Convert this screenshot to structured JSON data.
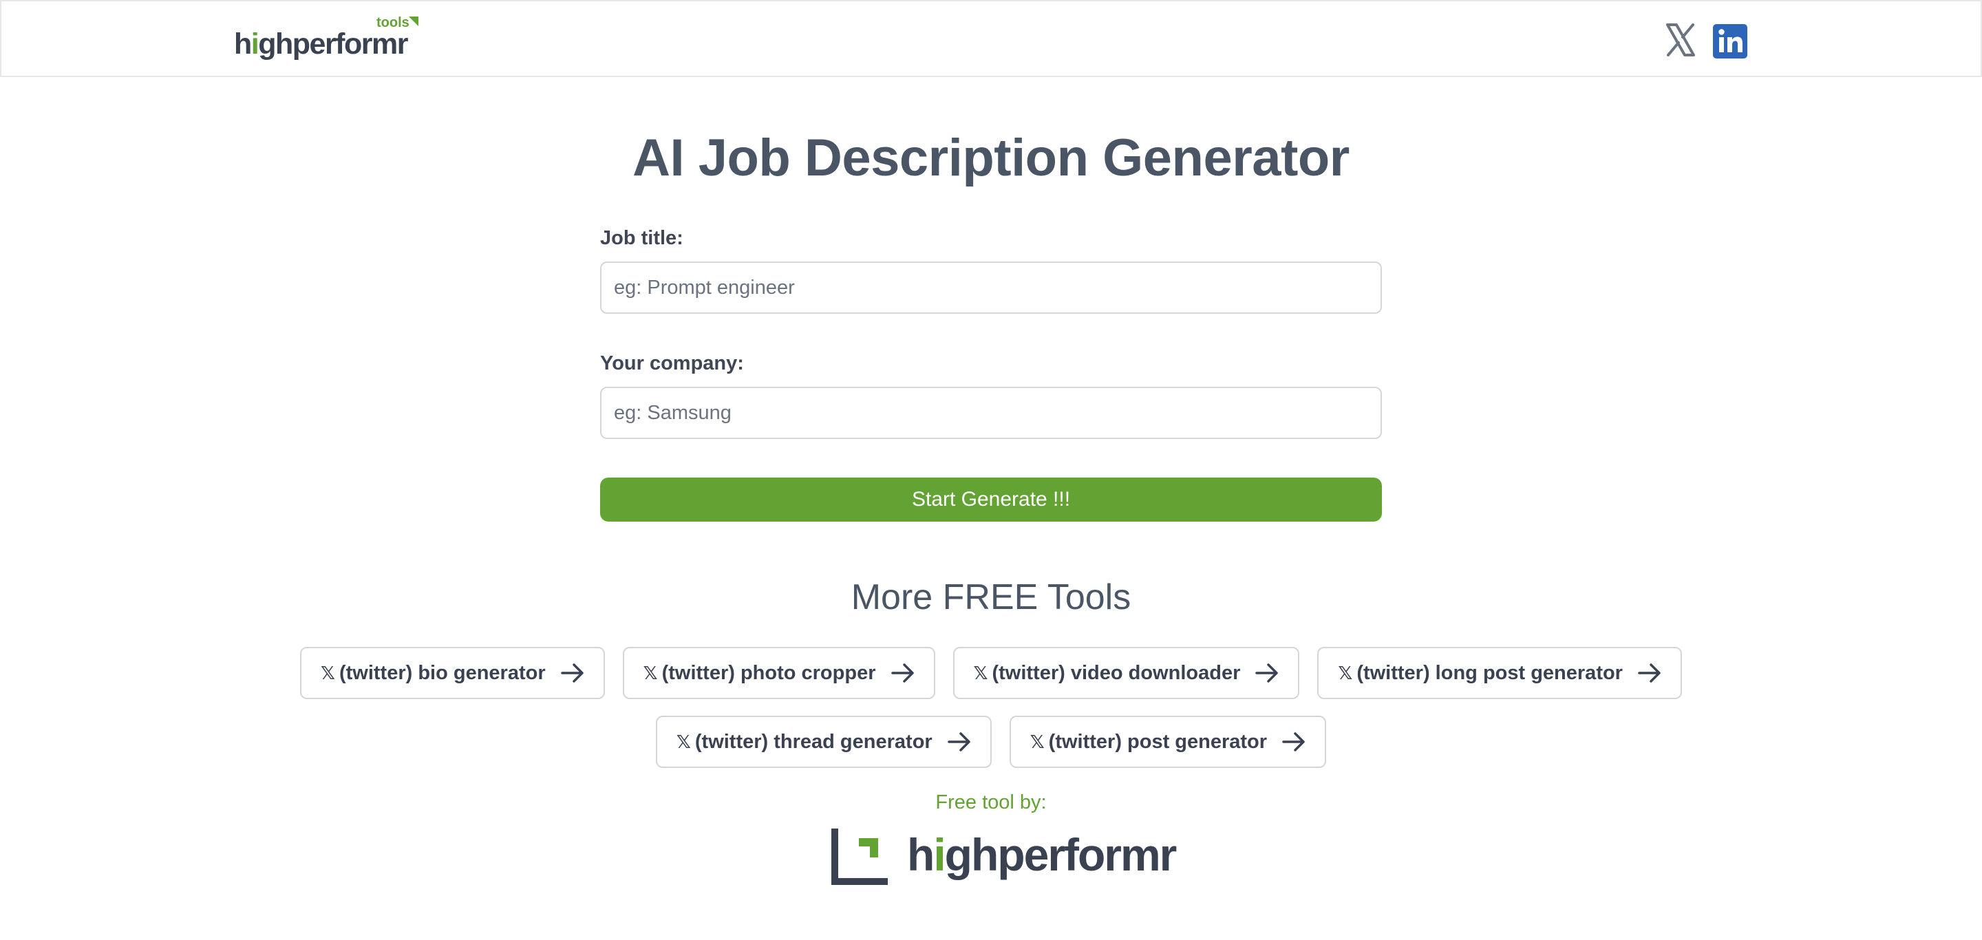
{
  "header": {
    "brand": {
      "word_prefix": "h",
      "word_dot": "i",
      "word_rest": "ghperformr",
      "tools": "tools"
    },
    "social": [
      {
        "name": "x",
        "icon": "x-logo-icon"
      },
      {
        "name": "linkedin",
        "icon": "linkedin-icon",
        "glyph": "in"
      }
    ]
  },
  "main": {
    "title": "AI Job Description Generator",
    "form": {
      "job_title_label": "Job title:",
      "job_title_placeholder": "eg: Prompt engineer",
      "company_label": "Your company:",
      "company_placeholder": "eg: Samsung",
      "submit_label": "Start Generate !!!"
    },
    "more_tools": {
      "title": "More FREE Tools",
      "x_glyph": "𝕏",
      "row1": [
        {
          "label": "(twitter) bio generator"
        },
        {
          "label": "(twitter) photo cropper"
        },
        {
          "label": "(twitter) video downloader"
        },
        {
          "label": "(twitter) long post generator"
        }
      ],
      "row2": [
        {
          "label": "(twitter) thread generator"
        },
        {
          "label": "(twitter) post generator"
        }
      ]
    }
  },
  "footer": {
    "credit": "Free tool by:",
    "brand": {
      "word_prefix": "h",
      "word_dot": "i",
      "word_rest": "ghperformr"
    }
  },
  "colors": {
    "accent_green": "#62a333",
    "text_dark": "#3a4252",
    "title": "#4a5566",
    "linkedin_blue": "#2d66b8",
    "border": "#d4d6dc"
  }
}
